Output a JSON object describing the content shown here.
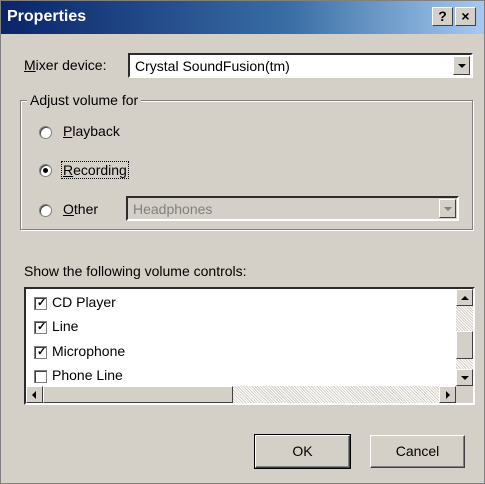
{
  "window": {
    "title": "Properties",
    "help_button": "?",
    "close_button": "×"
  },
  "mixer": {
    "label_prefix": "M",
    "label_rest": "ixer device:",
    "value": "Crystal SoundFusion(tm)"
  },
  "adjust_volume": {
    "legend": "Adjust volume for",
    "options": [
      {
        "label_prefix": "P",
        "label_rest": "layback",
        "selected": false
      },
      {
        "label_prefix": "R",
        "label_rest": "ecording",
        "selected": true
      },
      {
        "label_prefix": "O",
        "label_rest": "ther",
        "selected": false
      }
    ],
    "other_device": "Headphones"
  },
  "controls": {
    "heading": "Show the following volume controls:",
    "items": [
      {
        "label": "CD Player",
        "checked": true,
        "check_glyph": "✓"
      },
      {
        "label": "Line",
        "checked": true,
        "check_glyph": "✓"
      },
      {
        "label": "Microphone",
        "checked": true,
        "check_glyph": "✓"
      },
      {
        "label": "Phone Line",
        "checked": false,
        "check_glyph": ""
      }
    ]
  },
  "buttons": {
    "ok": "OK",
    "cancel": "Cancel"
  }
}
